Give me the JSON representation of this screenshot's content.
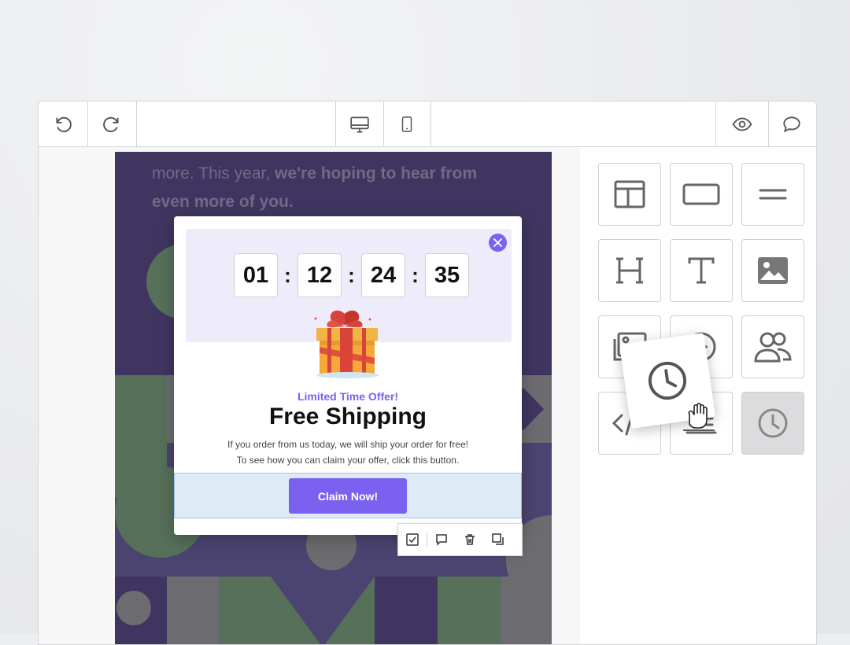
{
  "canvas": {
    "text_plain_1": "more. This year, ",
    "text_bold_1": "we're hoping to hear from",
    "text_bold_2": "even more of you."
  },
  "popup": {
    "timer": {
      "hours": "01",
      "minutes": "12",
      "seconds": "24",
      "frames": "35",
      "separator": ":"
    },
    "offer_label": "Limited Time Offer!",
    "title": "Free Shipping",
    "body_line_1": "If you order from us today, we will ship your order for free!",
    "body_line_2": "To see how you can claim your offer, click this button.",
    "cta_label": "Claim Now!"
  },
  "colors": {
    "accent": "#7b61f0",
    "canvas_bg": "#3f3560",
    "selection": "#deebf7"
  },
  "toolbar": {
    "icons": [
      "undo-icon",
      "redo-icon",
      "desktop-icon",
      "mobile-icon",
      "preview-icon",
      "comment-icon"
    ]
  },
  "blocks": [
    "layout",
    "button",
    "divider",
    "heading",
    "text",
    "image",
    "gallery",
    "video",
    "social",
    "html",
    "menu",
    "timer"
  ]
}
